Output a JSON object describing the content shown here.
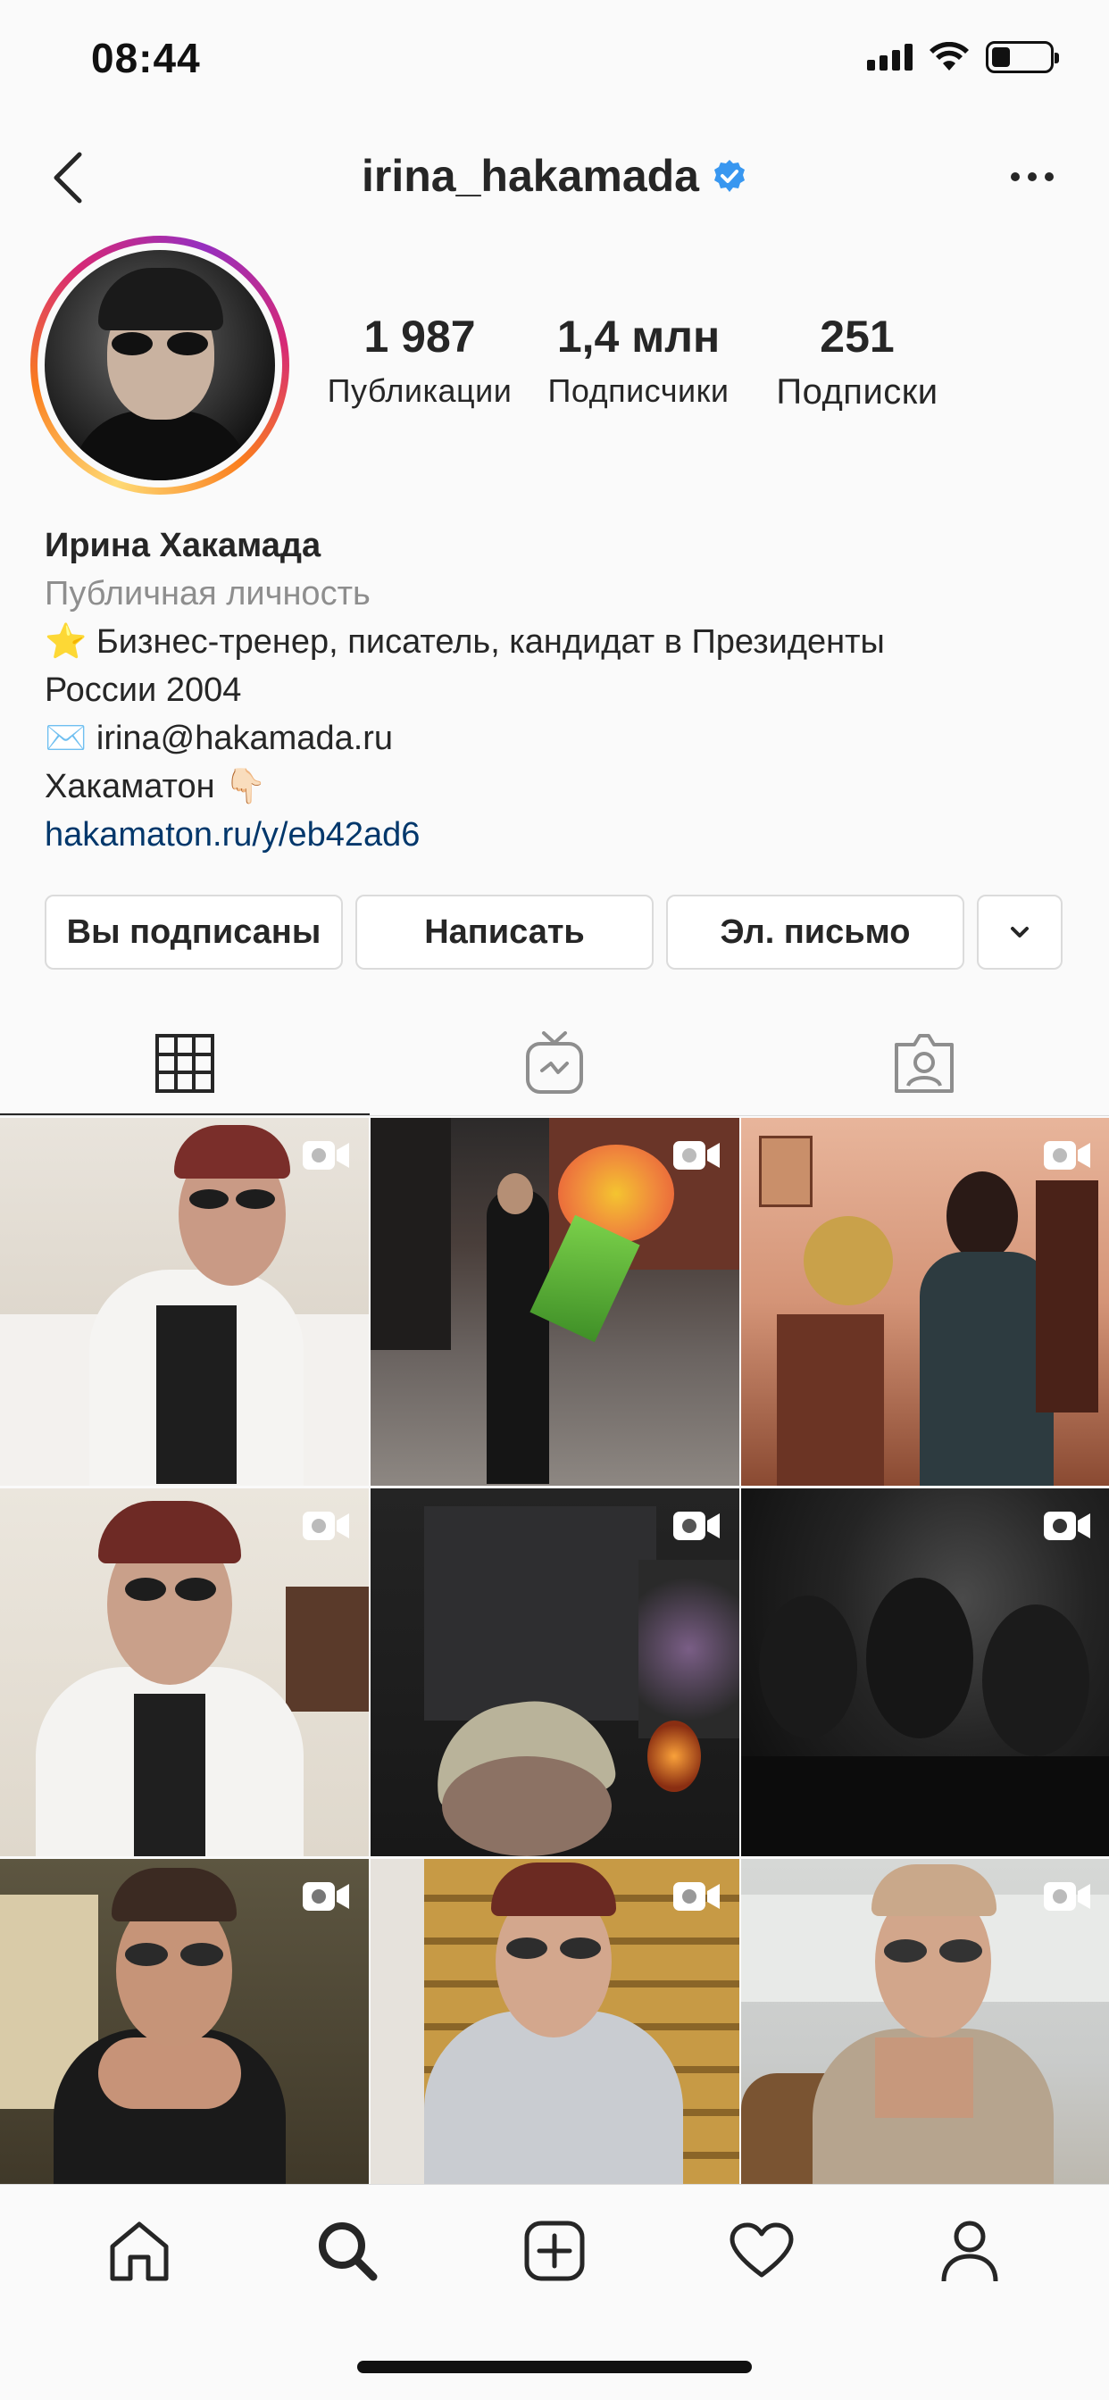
{
  "status_bar": {
    "time": "08:44"
  },
  "header": {
    "username": "irina_hakamada",
    "verified": true
  },
  "profile": {
    "stats": [
      {
        "value": "1 987",
        "label": "Публикации"
      },
      {
        "value": "1,4 млн",
        "label": "Подписчики"
      },
      {
        "value": "251",
        "label": "Подписки"
      }
    ],
    "name": "Ирина Хакамада",
    "category": "Публичная личность",
    "bio_line1": "⭐ Бизнес-тренер, писатель, кандидат в Президенты",
    "bio_line2": "России 2004",
    "bio_line3": "✉️ irina@hakamada.ru",
    "bio_line4": "Хакаматон 👇🏻",
    "link": "hakamaton.ru/y/eb42ad6"
  },
  "buttons": {
    "following": "Вы подписаны",
    "message": "Написать",
    "email": "Эл. письмо"
  },
  "tabs": [
    "grid-icon",
    "igtv-icon",
    "tagged-icon"
  ],
  "grid": {
    "posts": [
      {
        "type": "video"
      },
      {
        "type": "video"
      },
      {
        "type": "video"
      },
      {
        "type": "video"
      },
      {
        "type": "video"
      },
      {
        "type": "video"
      },
      {
        "type": "video"
      },
      {
        "type": "video"
      },
      {
        "type": "video"
      }
    ]
  },
  "nav": [
    "home-icon",
    "search-icon",
    "new-post-icon",
    "activity-icon",
    "profile-icon"
  ],
  "colors": {
    "link": "#00376b",
    "verified": "#3897f0",
    "muted": "#8e8e8e"
  }
}
